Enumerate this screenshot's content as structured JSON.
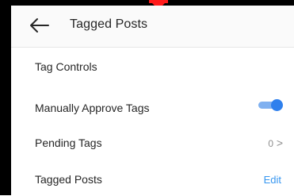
{
  "header": {
    "title": "Tagged Posts"
  },
  "sections": {
    "tag_controls_label": "Tag Controls"
  },
  "rows": {
    "manually_approve": {
      "label": "Manually Approve Tags",
      "enabled": true
    },
    "pending_tags": {
      "label": "Pending Tags",
      "count": "0",
      "chevron": ">"
    },
    "tagged_posts": {
      "label": "Tagged Posts",
      "action": "Edit"
    }
  },
  "icons": {
    "back": "arrow-left-icon",
    "chevron": "chevron-right-icon"
  },
  "colors": {
    "toggle_on": "#2f80ed",
    "link": "#3897f0",
    "marker": "#ff1a1a"
  }
}
